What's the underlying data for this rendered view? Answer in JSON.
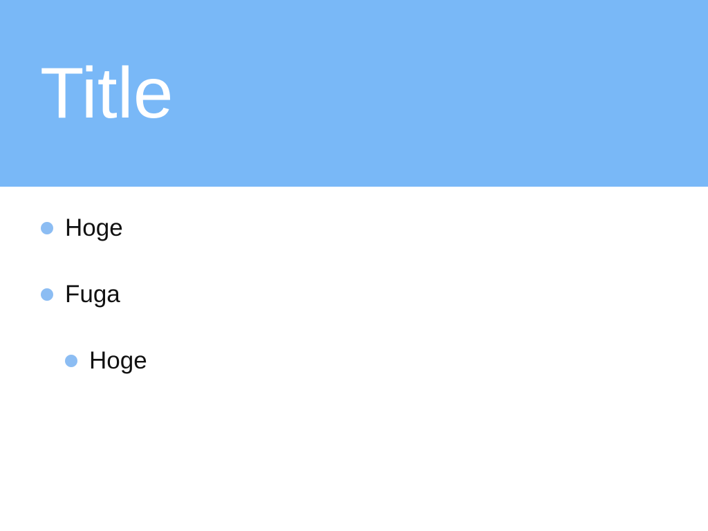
{
  "colors": {
    "header_background": "#79b8f7",
    "title_text": "#ffffff",
    "bullet_dot": "#8cbdf3",
    "body_text": "#111111"
  },
  "header": {
    "title": "Title"
  },
  "bullets": [
    {
      "text": "Hoge",
      "level": 1
    },
    {
      "text": "Fuga",
      "level": 1
    },
    {
      "text": "Hoge",
      "level": 2
    }
  ]
}
